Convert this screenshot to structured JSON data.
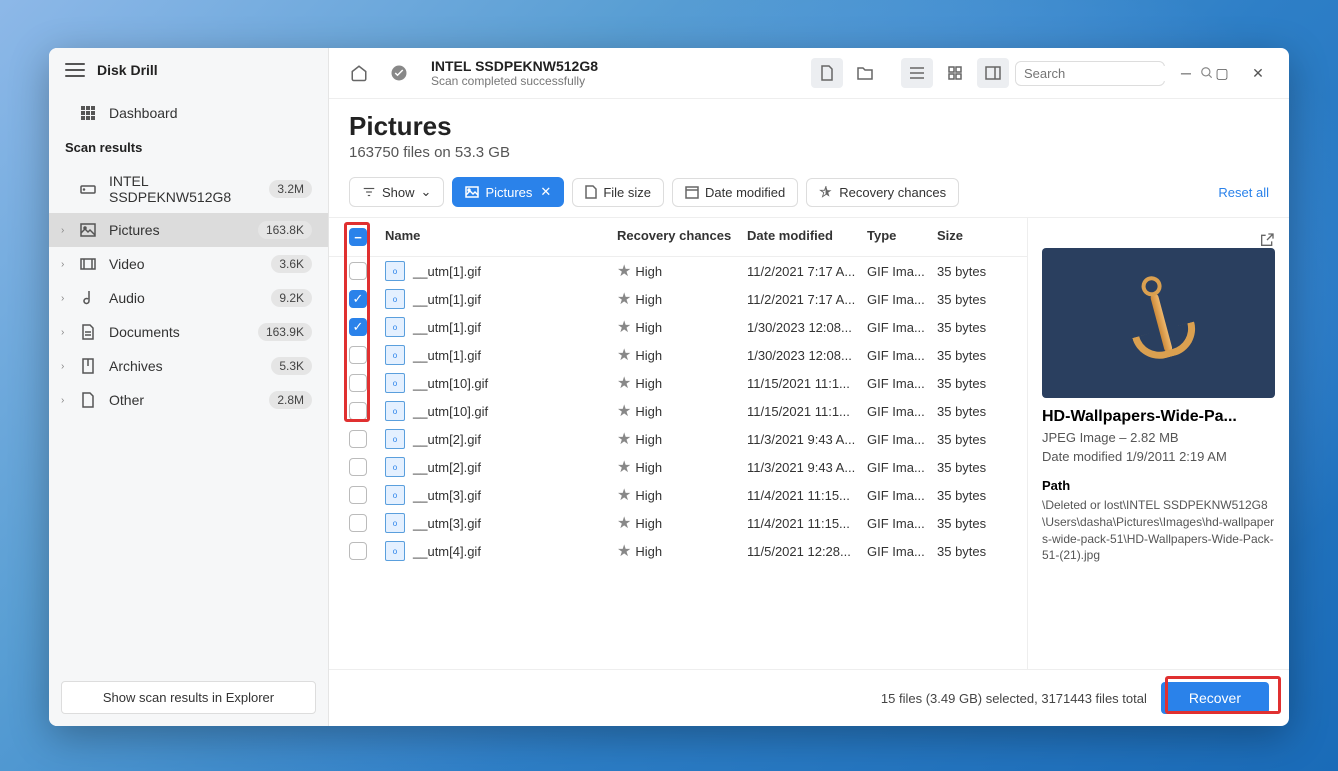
{
  "app": {
    "title": "Disk Drill"
  },
  "sidebar": {
    "dashboard": "Dashboard",
    "scan_results_header": "Scan results",
    "items": [
      {
        "label": "INTEL SSDPEKNW512G8",
        "badge": "3.2M",
        "icon": "disk"
      },
      {
        "label": "Pictures",
        "badge": "163.8K",
        "icon": "pictures"
      },
      {
        "label": "Video",
        "badge": "3.6K",
        "icon": "video"
      },
      {
        "label": "Audio",
        "badge": "9.2K",
        "icon": "audio"
      },
      {
        "label": "Documents",
        "badge": "163.9K",
        "icon": "documents"
      },
      {
        "label": "Archives",
        "badge": "5.3K",
        "icon": "archives"
      },
      {
        "label": "Other",
        "badge": "2.8M",
        "icon": "other"
      }
    ],
    "footer_btn": "Show scan results in Explorer"
  },
  "toolbar": {
    "scan_title": "INTEL SSDPEKNW512G8",
    "scan_subtitle": "Scan completed successfully",
    "search_placeholder": "Search"
  },
  "page": {
    "title": "Pictures",
    "subtitle": "163750 files on 53.3 GB"
  },
  "filters": {
    "show": "Show",
    "pictures": "Pictures",
    "file_size": "File size",
    "date_modified": "Date modified",
    "recovery_chances": "Recovery chances",
    "reset": "Reset all"
  },
  "columns": {
    "name": "Name",
    "recovery": "Recovery chances",
    "date": "Date modified",
    "type": "Type",
    "size": "Size"
  },
  "rows": [
    {
      "checked": false,
      "name": "__utm[1].gif",
      "recovery": "High",
      "date": "11/2/2021 7:17 A...",
      "type": "GIF Ima...",
      "size": "35 bytes"
    },
    {
      "checked": true,
      "name": "__utm[1].gif",
      "recovery": "High",
      "date": "11/2/2021 7:17 A...",
      "type": "GIF Ima...",
      "size": "35 bytes"
    },
    {
      "checked": true,
      "name": "__utm[1].gif",
      "recovery": "High",
      "date": "1/30/2023 12:08...",
      "type": "GIF Ima...",
      "size": "35 bytes"
    },
    {
      "checked": false,
      "name": "__utm[1].gif",
      "recovery": "High",
      "date": "1/30/2023 12:08...",
      "type": "GIF Ima...",
      "size": "35 bytes"
    },
    {
      "checked": false,
      "name": "__utm[10].gif",
      "recovery": "High",
      "date": "11/15/2021 11:1...",
      "type": "GIF Ima...",
      "size": "35 bytes"
    },
    {
      "checked": false,
      "name": "__utm[10].gif",
      "recovery": "High",
      "date": "11/15/2021 11:1...",
      "type": "GIF Ima...",
      "size": "35 bytes"
    },
    {
      "checked": false,
      "name": "__utm[2].gif",
      "recovery": "High",
      "date": "11/3/2021 9:43 A...",
      "type": "GIF Ima...",
      "size": "35 bytes"
    },
    {
      "checked": false,
      "name": "__utm[2].gif",
      "recovery": "High",
      "date": "11/3/2021 9:43 A...",
      "type": "GIF Ima...",
      "size": "35 bytes"
    },
    {
      "checked": false,
      "name": "__utm[3].gif",
      "recovery": "High",
      "date": "11/4/2021 11:15...",
      "type": "GIF Ima...",
      "size": "35 bytes"
    },
    {
      "checked": false,
      "name": "__utm[3].gif",
      "recovery": "High",
      "date": "11/4/2021 11:15...",
      "type": "GIF Ima...",
      "size": "35 bytes"
    },
    {
      "checked": false,
      "name": "__utm[4].gif",
      "recovery": "High",
      "date": "11/5/2021 12:28...",
      "type": "GIF Ima...",
      "size": "35 bytes"
    }
  ],
  "preview": {
    "title": "HD-Wallpapers-Wide-Pa...",
    "meta1": "JPEG Image – 2.82 MB",
    "meta2": "Date modified 1/9/2011 2:19 AM",
    "path_label": "Path",
    "path": "\\Deleted or lost\\INTEL SSDPEKNW512G8\\Users\\dasha\\Pictures\\Images\\hd-wallpapers-wide-pack-51\\HD-Wallpapers-Wide-Pack-51-(21).jpg"
  },
  "footer": {
    "status": "15 files (3.49 GB) selected, 3171443 files total",
    "recover": "Recover"
  }
}
